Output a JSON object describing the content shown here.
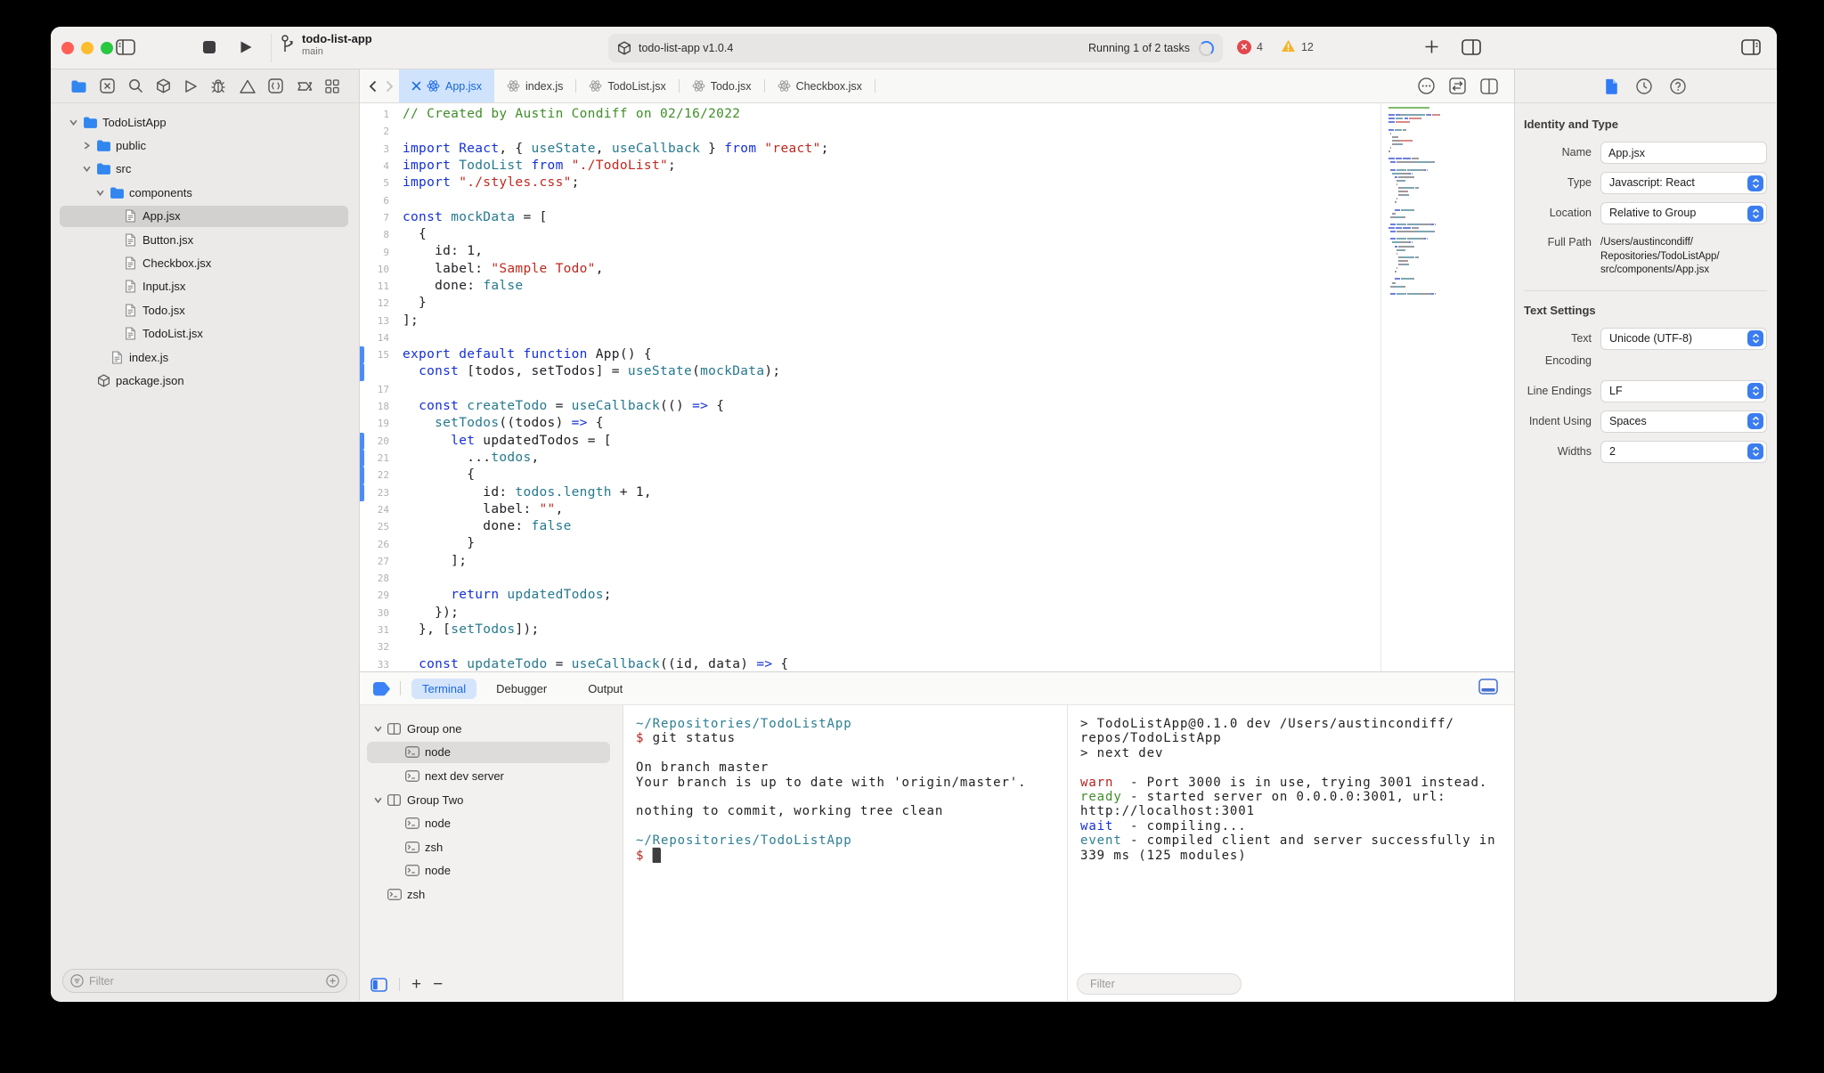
{
  "toolbar": {
    "project_name": "todo-list-app",
    "branch_name": "main",
    "scheme_label": "todo-list-app v1.0.4",
    "running_text": "Running 1 of 2 tasks",
    "error_count": "4",
    "warning_count": "12"
  },
  "navigator": {
    "filter_placeholder": "Filter",
    "tree": [
      {
        "label": "TodoListApp",
        "level": 0,
        "kind": "folder",
        "chevron": "down"
      },
      {
        "label": "public",
        "level": 1,
        "kind": "folder",
        "chevron": "right"
      },
      {
        "label": "src",
        "level": 1,
        "kind": "folder",
        "chevron": "down"
      },
      {
        "label": "components",
        "level": 2,
        "kind": "folder",
        "chevron": "down"
      },
      {
        "label": "App.jsx",
        "level": 3,
        "kind": "file",
        "selected": true
      },
      {
        "label": "Button.jsx",
        "level": 3,
        "kind": "file"
      },
      {
        "label": "Checkbox.jsx",
        "level": 3,
        "kind": "file"
      },
      {
        "label": "Input.jsx",
        "level": 3,
        "kind": "file"
      },
      {
        "label": "Todo.jsx",
        "level": 3,
        "kind": "file"
      },
      {
        "label": "TodoList.jsx",
        "level": 3,
        "kind": "file"
      },
      {
        "label": "index.js",
        "level": 2,
        "kind": "file"
      },
      {
        "label": "package.json",
        "level": 1,
        "kind": "package"
      }
    ]
  },
  "tabs": [
    {
      "label": "App.jsx",
      "active": true
    },
    {
      "label": "index.js",
      "active": false
    },
    {
      "label": "TodoList.jsx",
      "active": false
    },
    {
      "label": "Todo.jsx",
      "active": false
    },
    {
      "label": "Checkbox.jsx",
      "active": false
    }
  ],
  "editor": {
    "lines": [
      {
        "n": "1",
        "t": [
          [
            "c",
            "// Created by Austin Condiff on 02/16/2022"
          ]
        ]
      },
      {
        "n": "2",
        "t": []
      },
      {
        "n": "3",
        "t": [
          [
            "k",
            "import"
          ],
          [
            "p",
            " "
          ],
          [
            "k",
            "React"
          ],
          [
            "p",
            ", { "
          ],
          [
            "t",
            "useState"
          ],
          [
            "p",
            ", "
          ],
          [
            "t",
            "useCallback"
          ],
          [
            "p",
            " } "
          ],
          [
            "k",
            "from"
          ],
          [
            "p",
            " "
          ],
          [
            "s",
            "\"react\""
          ],
          [
            "p",
            ";"
          ]
        ]
      },
      {
        "n": "4",
        "t": [
          [
            "k",
            "import"
          ],
          [
            "p",
            " "
          ],
          [
            "t",
            "TodoList"
          ],
          [
            "p",
            " "
          ],
          [
            "k",
            "from"
          ],
          [
            "p",
            " "
          ],
          [
            "s",
            "\"./TodoList\""
          ],
          [
            "p",
            ";"
          ]
        ]
      },
      {
        "n": "5",
        "t": [
          [
            "k",
            "import"
          ],
          [
            "p",
            " "
          ],
          [
            "s",
            "\"./styles.css\""
          ],
          [
            "p",
            ";"
          ]
        ]
      },
      {
        "n": "6",
        "t": []
      },
      {
        "n": "7",
        "t": [
          [
            "k",
            "const"
          ],
          [
            "p",
            " "
          ],
          [
            "t",
            "mockData"
          ],
          [
            "p",
            " = ["
          ]
        ]
      },
      {
        "n": "8",
        "t": [
          [
            "p",
            "  {"
          ]
        ]
      },
      {
        "n": "9",
        "t": [
          [
            "p",
            "    id: 1,"
          ]
        ]
      },
      {
        "n": "10",
        "t": [
          [
            "p",
            "    label: "
          ],
          [
            "s",
            "\"Sample Todo\""
          ],
          [
            "p",
            ","
          ]
        ]
      },
      {
        "n": "11",
        "t": [
          [
            "p",
            "    done: "
          ],
          [
            "t",
            "false"
          ]
        ]
      },
      {
        "n": "12",
        "t": [
          [
            "p",
            "  }"
          ]
        ]
      },
      {
        "n": "13",
        "t": [
          [
            "p",
            "];"
          ]
        ]
      },
      {
        "n": "14",
        "t": []
      },
      {
        "n": "15",
        "b": 1,
        "t": [
          [
            "k",
            "export"
          ],
          [
            "p",
            " "
          ],
          [
            "k",
            "default"
          ],
          [
            "p",
            " "
          ],
          [
            "k",
            "function"
          ],
          [
            "p",
            " App() {"
          ]
        ]
      },
      {
        "n": "",
        "b": 1,
        "t": [
          [
            "p",
            "  "
          ],
          [
            "k",
            "const"
          ],
          [
            "p",
            " [todos, setTodos] = "
          ],
          [
            "t",
            "useState"
          ],
          [
            "p",
            "("
          ],
          [
            "t",
            "mockData"
          ],
          [
            "p",
            ");"
          ]
        ]
      },
      {
        "n": "17",
        "t": []
      },
      {
        "n": "18",
        "t": [
          [
            "p",
            "  "
          ],
          [
            "k",
            "const"
          ],
          [
            "p",
            " "
          ],
          [
            "t",
            "createTodo"
          ],
          [
            "p",
            " = "
          ],
          [
            "t",
            "useCallback"
          ],
          [
            "p",
            "(() "
          ],
          [
            "k",
            "=>"
          ],
          [
            "p",
            " {"
          ]
        ]
      },
      {
        "n": "19",
        "t": [
          [
            "p",
            "    "
          ],
          [
            "t",
            "setTodos"
          ],
          [
            "p",
            "((todos) "
          ],
          [
            "k",
            "=>"
          ],
          [
            "p",
            " {"
          ]
        ]
      },
      {
        "n": "20",
        "b": 1,
        "t": [
          [
            "p",
            "      "
          ],
          [
            "k",
            "let"
          ],
          [
            "p",
            " updatedTodos = ["
          ]
        ]
      },
      {
        "n": "21",
        "b": 1,
        "t": [
          [
            "p",
            "        ..."
          ],
          [
            "t",
            "todos"
          ],
          [
            "p",
            ","
          ]
        ]
      },
      {
        "n": "22",
        "b": 1,
        "t": [
          [
            "p",
            "        {"
          ]
        ]
      },
      {
        "n": "23",
        "b": 1,
        "t": [
          [
            "p",
            "          id: "
          ],
          [
            "t",
            "todos.length"
          ],
          [
            "p",
            " + 1,"
          ]
        ]
      },
      {
        "n": "24",
        "t": [
          [
            "p",
            "          label: "
          ],
          [
            "s",
            "\"\""
          ],
          [
            "p",
            ","
          ]
        ]
      },
      {
        "n": "25",
        "t": [
          [
            "p",
            "          done: "
          ],
          [
            "t",
            "false"
          ]
        ]
      },
      {
        "n": "26",
        "t": [
          [
            "p",
            "        }"
          ]
        ]
      },
      {
        "n": "27",
        "t": [
          [
            "p",
            "      ];"
          ]
        ]
      },
      {
        "n": "28",
        "t": []
      },
      {
        "n": "29",
        "t": [
          [
            "p",
            "      "
          ],
          [
            "k",
            "return"
          ],
          [
            "p",
            " "
          ],
          [
            "t",
            "updatedTodos"
          ],
          [
            "p",
            ";"
          ]
        ]
      },
      {
        "n": "30",
        "t": [
          [
            "p",
            "    });"
          ]
        ]
      },
      {
        "n": "31",
        "t": [
          [
            "p",
            "  }, ["
          ],
          [
            "t",
            "setTodos"
          ],
          [
            "p",
            "]);"
          ]
        ]
      },
      {
        "n": "32",
        "t": []
      },
      {
        "n": "33",
        "t": [
          [
            "p",
            "  "
          ],
          [
            "k",
            "const"
          ],
          [
            "p",
            " "
          ],
          [
            "t",
            "updateTodo"
          ],
          [
            "p",
            " = "
          ],
          [
            "t",
            "useCallback"
          ],
          [
            "p",
            "((id, data) "
          ],
          [
            "k",
            "=>"
          ],
          [
            "p",
            " {"
          ]
        ]
      }
    ]
  },
  "inspector": {
    "identity": {
      "heading": "Identity and Type",
      "name_label": "Name",
      "name_value": "App.jsx",
      "type_label": "Type",
      "type_value": "Javascript: React",
      "location_label": "Location",
      "location_value": "Relative to Group",
      "fullpath_label": "Full Path",
      "fullpath_lines": [
        "/Users/austincondiff/",
        "Repositories/TodoListApp/",
        "src/components/App.jsx"
      ]
    },
    "text_settings": {
      "heading": "Text Settings",
      "rows": [
        {
          "label": "Text Encoding",
          "value": "Unicode (UTF-8)"
        },
        {
          "label": "Line Endings",
          "value": "LF"
        },
        {
          "label": "Indent Using",
          "value": "Spaces"
        },
        {
          "label": "Widths",
          "value": "2"
        }
      ]
    }
  },
  "bottom": {
    "tabs": [
      {
        "label": "Terminal",
        "active": true
      },
      {
        "label": "Debugger",
        "active": false
      },
      {
        "label": "Output",
        "active": false
      }
    ],
    "sessions": [
      {
        "label": "Group one",
        "type": "group",
        "level": 0
      },
      {
        "label": "node",
        "type": "term",
        "level": 1,
        "selected": true
      },
      {
        "label": "next dev server",
        "type": "term",
        "level": 1
      },
      {
        "label": "Group Two",
        "type": "group",
        "level": 0
      },
      {
        "label": "node",
        "type": "term",
        "level": 1
      },
      {
        "label": "zsh",
        "type": "term",
        "level": 1
      },
      {
        "label": "node",
        "type": "term",
        "level": 1
      },
      {
        "label": "zsh",
        "type": "term",
        "level": 0
      }
    ],
    "terminal1": [
      [
        [
          "path",
          "~/Repositories/TodoListApp"
        ]
      ],
      [
        [
          "prompt",
          "$"
        ],
        [
          "txt",
          " git status"
        ]
      ],
      [],
      [
        [
          "txt",
          "On branch master"
        ]
      ],
      [
        [
          "txt",
          "Your branch is up to date with 'origin/master'."
        ]
      ],
      [],
      [
        [
          "txt",
          "nothing to commit, working tree clean"
        ]
      ],
      [],
      [
        [
          "path",
          "~/Repositories/TodoListApp"
        ]
      ],
      [
        [
          "prompt",
          "$"
        ],
        [
          "txt",
          " "
        ],
        [
          "cursor",
          "█"
        ]
      ]
    ],
    "terminal2": [
      [
        [
          "txt",
          "> TodoListApp@0.1.0 dev /Users/austincondiff/"
        ]
      ],
      [
        [
          "txt",
          "repos/TodoListApp"
        ]
      ],
      [
        [
          "txt",
          "> next dev"
        ]
      ],
      [],
      [
        [
          "warn",
          "warn"
        ],
        [
          "txt",
          "  - Port 3000 is in use, trying 3001 instead."
        ]
      ],
      [
        [
          "ready",
          "ready"
        ],
        [
          "txt",
          " - started server on 0.0.0.0:3001, url:"
        ]
      ],
      [
        [
          "txt",
          "http://localhost:3001"
        ]
      ],
      [
        [
          "wait",
          "wait"
        ],
        [
          "txt",
          "  - compiling..."
        ]
      ],
      [
        [
          "event",
          "event"
        ],
        [
          "txt",
          " - compiled client and server successfully in"
        ]
      ],
      [
        [
          "txt",
          "339 ms (125 modules)"
        ]
      ]
    ],
    "filter_placeholder": "Filter"
  },
  "colors": {
    "accent": "#3b82f6",
    "error": "#e3484d",
    "warning": "#f3b32a",
    "traffic_red": "#ff5f57",
    "traffic_yellow": "#febc2e",
    "traffic_green": "#28c840"
  }
}
